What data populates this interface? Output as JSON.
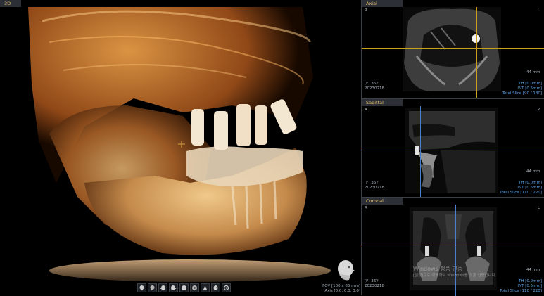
{
  "panes": {
    "view3d": {
      "title": "3D",
      "fov": "FOV [100 x 85 mm]",
      "axis": "Axis [0.0, 0.0, 0.0]"
    },
    "axial": {
      "title": "Axial",
      "left_marker": "R",
      "right_marker": "L",
      "info_left_1": "[F] 36Y",
      "info_left_2": "20230218",
      "scale": "44 mm",
      "info_right_1": "TH [0.0mm]",
      "info_right_2": "INT [0.5mm]",
      "info_right_3": "Total Slice [90 / 180]"
    },
    "sagittal": {
      "title": "Sagittal",
      "left_marker": "A",
      "right_marker": "P",
      "info_left_1": "[F] 36Y",
      "info_left_2": "20230218",
      "scale": "44 mm",
      "info_right_1": "TH [0.0mm]",
      "info_right_2": "INT [0.5mm]",
      "info_right_3": "Total Slice [110 / 220]"
    },
    "coronal": {
      "title": "Coronal",
      "left_marker": "R",
      "right_marker": "L",
      "info_left_1": "[F] 36Y",
      "info_left_2": "20230218",
      "scale": "44 mm",
      "info_right_1": "TH [0.0mm]",
      "info_right_2": "INT [0.5mm]",
      "info_right_3": "Total Slice [110 / 220]"
    }
  },
  "toolbar": {
    "buttons": [
      "view-front-icon",
      "view-back-icon",
      "view-left-icon",
      "view-right-icon",
      "view-top-icon",
      "view-bottom-icon",
      "view-oblique-icon",
      "view-iso-icon",
      "view-reset-icon"
    ]
  },
  "watermark": {
    "line1": "Windows 정품 인증",
    "line2": "[설정]으로 이동하여 Windows를 정품 인증합니다."
  },
  "colors": {
    "title_bar": "#2c3036",
    "crosshair_blue": "#4a7fcf",
    "crosshair_yellow": "#c9a11a",
    "bone": "#d4832c"
  }
}
